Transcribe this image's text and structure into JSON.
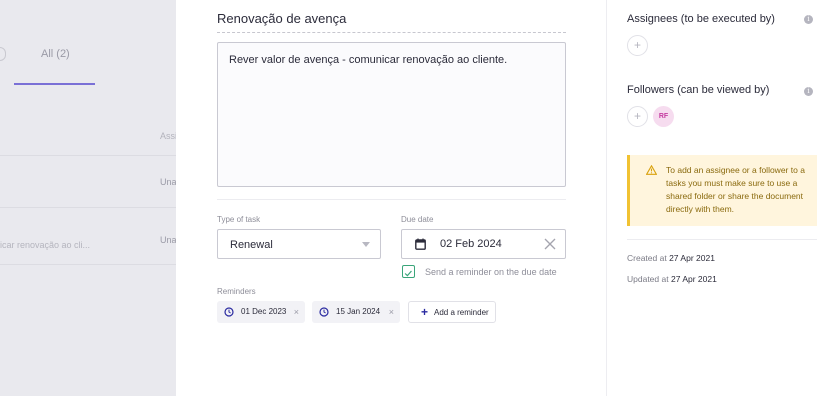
{
  "background_list": {
    "tab_all": "All (2)",
    "column_header": "Assi",
    "rows": [
      {
        "cell": "Una",
        "description": ""
      },
      {
        "cell": "Una",
        "description": "icar renovação ao cli..."
      }
    ]
  },
  "task": {
    "title": "Renovação de avença",
    "description": "Rever valor de avença - comunicar renovação ao cliente.",
    "type_label": "Type of task",
    "type_value": "Renewal",
    "due_label": "Due date",
    "due_value": "02 Feb 2024",
    "send_reminder_label": "Send a reminder on the due date",
    "send_reminder_checked": true,
    "reminders_label": "Reminders",
    "reminders": [
      "01 Dec 2023",
      "15 Jan 2024"
    ],
    "add_reminder_label": "Add a reminder"
  },
  "right_panel": {
    "assignees_title": "Assignees (to be executed by)",
    "followers_title": "Followers (can be viewed by)",
    "follower_initials": "RF",
    "warning_text": "To add an assignee or a follower to a tasks you must make sure to use a shared folder or share the document directly with them.",
    "created_label": "Created at",
    "created_value": "27 Apr 2021",
    "updated_label": "Updated at",
    "updated_value": "27 Apr 2021"
  },
  "colors": {
    "accent": "#7a70d6",
    "check": "#3aa57a",
    "warning_bg": "#fff5dd",
    "warning_border": "#f1c232",
    "avatar_bg": "#f6dcef",
    "avatar_fg": "#c43aa0",
    "icon_blue": "#2a2aa0"
  }
}
